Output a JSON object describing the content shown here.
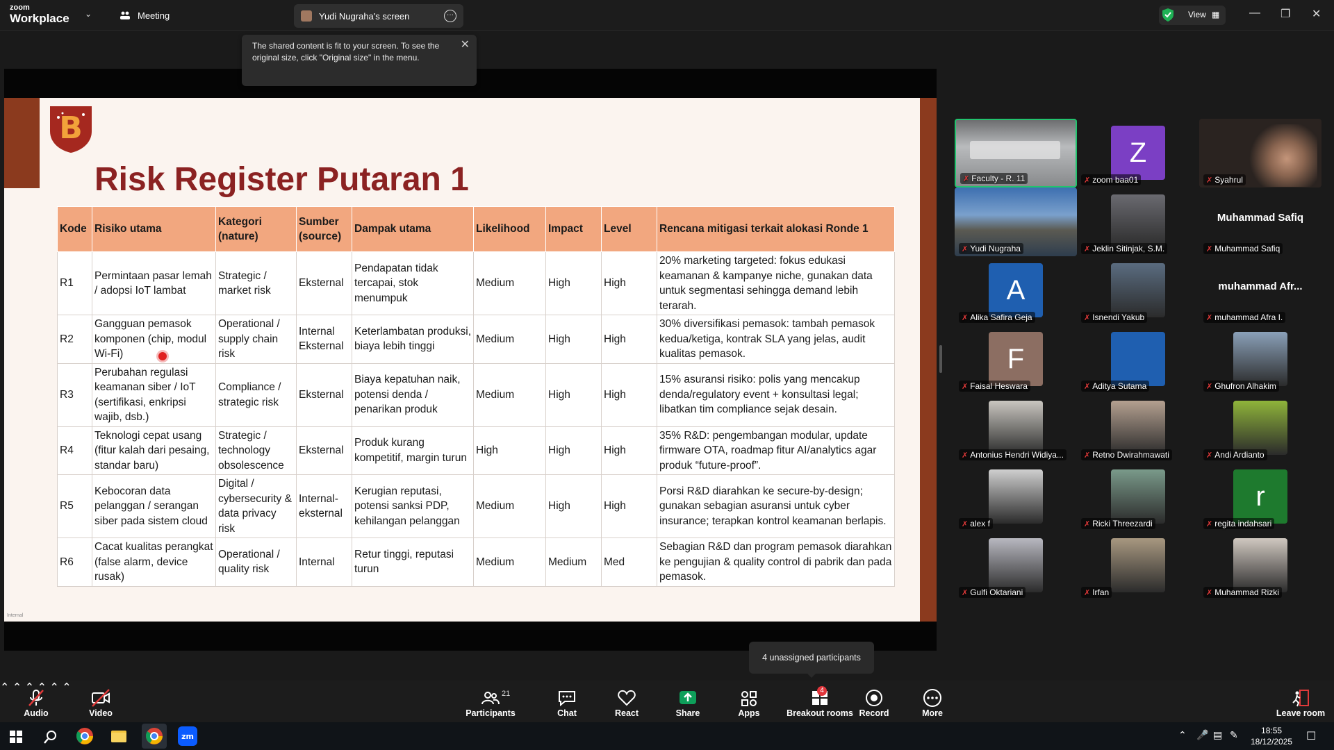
{
  "topbar": {
    "brand_small": "zoom",
    "brand_large": "Workplace",
    "meeting_label": "Meeting",
    "share_tab_label": "Yudi Nugraha's screen",
    "view_label": "View"
  },
  "tooltip": {
    "text": "The shared content is fit to your screen. To see the original size, click \"Original size\" in the menu."
  },
  "slide": {
    "title": "Risk Register Putaran 1",
    "footer_tag": "Internal",
    "headers": [
      "Kode",
      "Risiko utama",
      "Kategori (nature)",
      "Sumber (source)",
      "Dampak utama",
      "Likelihood",
      "Impact",
      "Level",
      "Rencana mitigasi terkait alokasi Ronde 1"
    ],
    "rows": [
      {
        "kode": "R1",
        "risiko": "Permintaan pasar lemah / adopsi IoT lambat",
        "kategori": "Strategic / market risk",
        "sumber": "Eksternal",
        "dampak": "Pendapatan tidak tercapai, stok menumpuk",
        "likelihood": "Medium",
        "impact": "High",
        "level": "High",
        "mitigasi": "20% marketing targeted: fokus edukasi keamanan & kampanye niche, gunakan data untuk segmentasi sehingga demand lebih terarah."
      },
      {
        "kode": "R2",
        "risiko": "Gangguan pemasok komponen (chip, modul Wi-Fi)",
        "kategori": "Operational / supply chain risk",
        "sumber": "Internal Eksternal",
        "dampak": "Keterlambatan produksi, biaya lebih tinggi",
        "likelihood": "Medium",
        "impact": "High",
        "level": "High",
        "mitigasi": "30% diversifikasi pemasok: tambah pemasok kedua/ketiga, kontrak SLA yang jelas, audit kualitas pemasok."
      },
      {
        "kode": "R3",
        "risiko": "Perubahan regulasi keamanan siber / IoT (sertifikasi, enkripsi wajib, dsb.)",
        "kategori": "Compliance / strategic risk",
        "sumber": "Eksternal",
        "dampak": "Biaya kepatuhan naik, potensi denda / penarikan produk",
        "likelihood": "Medium",
        "impact": "High",
        "level": "High",
        "mitigasi": "15% asuransi risiko: polis yang mencakup denda/regulatory event + konsultasi legal; libatkan tim compliance sejak desain."
      },
      {
        "kode": "R4",
        "risiko": "Teknologi cepat usang (fitur kalah dari pesaing, standar baru)",
        "kategori": "Strategic / technology obsolescence",
        "sumber": "Eksternal",
        "dampak": "Produk kurang kompetitif, margin turun",
        "likelihood": "High",
        "impact": "High",
        "level": "High",
        "mitigasi": "35% R&D: pengembangan modular, update firmware OTA, roadmap fitur AI/analytics agar produk “future-proof”."
      },
      {
        "kode": "R5",
        "risiko": "Kebocoran data pelanggan / serangan siber pada sistem cloud",
        "kategori": "Digital / cybersecurity & data privacy risk",
        "sumber": "Internal-eksternal",
        "dampak": "Kerugian reputasi, potensi sanksi PDP, kehilangan pelanggan",
        "likelihood": "Medium",
        "impact": "High",
        "level": "High",
        "mitigasi": "Porsi R&D diarahkan ke secure-by-design; gunakan sebagian asuransi untuk cyber insurance; terapkan kontrol keamanan berlapis."
      },
      {
        "kode": "R6",
        "risiko": "Cacat kualitas perangkat (false alarm, device rusak)",
        "kategori": "Operational / quality risk",
        "sumber": "Internal",
        "dampak": "Retur tinggi, reputasi turun",
        "likelihood": "Medium",
        "impact": "Medium",
        "level": "Med",
        "mitigasi": "Sebagian R&D dan program pemasok diarahkan ke pengujian & quality control di pabrik dan pada pemasok."
      }
    ]
  },
  "participants_gallery": [
    {
      "name": "Faculty - R. 11",
      "kind": "room"
    },
    {
      "name": "zoom baa01",
      "kind": "letter",
      "letter": "Z",
      "color": "#7b3fc4"
    },
    {
      "name": "Syahrul",
      "kind": "photo",
      "color": "#3a3330"
    },
    {
      "name": "Yudi Nugraha",
      "kind": "landscape"
    },
    {
      "name": "Jeklin Sitinjak, S.M.",
      "kind": "photo",
      "color": "#6a6a70"
    },
    {
      "name": "Muhammad Safiq",
      "kind": "bigname",
      "big": "Muhammad Safiq"
    },
    {
      "name": "Alika Safira Geja",
      "kind": "letter",
      "letter": "A",
      "color": "#1f5fb0"
    },
    {
      "name": "Isnendi Yakub",
      "kind": "photo",
      "color": "#5a6c80"
    },
    {
      "name": "muhammad Afra I.",
      "kind": "bigname",
      "big": "muhammad Afr..."
    },
    {
      "name": "Faisal Heswara",
      "kind": "letter",
      "letter": "F",
      "color": "#8c6e62"
    },
    {
      "name": "Aditya Sutama",
      "kind": "letter",
      "letter": "",
      "color": "#1f5fb0"
    },
    {
      "name": "Ghufron Alhakim",
      "kind": "photo",
      "color": "#8aa0b8"
    },
    {
      "name": "Antonius Hendri Widiya...",
      "kind": "photo",
      "color": "#c9c6c0"
    },
    {
      "name": "Retno Dwirahmawati",
      "kind": "photo",
      "color": "#b4a090"
    },
    {
      "name": "Andi Ardianto",
      "kind": "photo",
      "color": "#8fb43a"
    },
    {
      "name": "alex f",
      "kind": "photo",
      "color": "#cfcfcf"
    },
    {
      "name": "Ricki Threezardi",
      "kind": "photo",
      "color": "#7a9a8a"
    },
    {
      "name": "regita indahsari",
      "kind": "letter",
      "letter": "r",
      "color": "#1e7a2e"
    },
    {
      "name": "Gulfi Oktariani",
      "kind": "photo",
      "color": "#b8b8c0"
    },
    {
      "name": "Irfan",
      "kind": "photo",
      "color": "#a89880"
    },
    {
      "name": "Muhammad Rizki",
      "kind": "photo",
      "color": "#d0c8c0"
    }
  ],
  "hint": {
    "text": "4 unassigned participants"
  },
  "toolbar": {
    "audio": "Audio",
    "video": "Video",
    "participants": "Participants",
    "participants_count": "21",
    "chat": "Chat",
    "react": "React",
    "share": "Share",
    "apps": "Apps",
    "breakout": "Breakout rooms",
    "breakout_badge": "4",
    "record": "Record",
    "more": "More",
    "leave": "Leave room"
  },
  "taskbar": {
    "time": "18:55",
    "date": "18/12/2025"
  },
  "colors": {
    "accent_green": "#22c36e",
    "slide_brand": "#8b2222",
    "table_header": "#f2a77f",
    "share_green": "#0e9f5a"
  }
}
